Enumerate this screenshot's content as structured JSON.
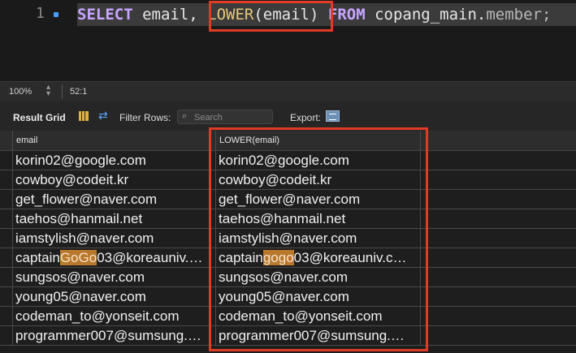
{
  "editor": {
    "line_number": "1",
    "code_parts": [
      {
        "text": "SELECT",
        "cls": "kw"
      },
      {
        "text": " email, ",
        "cls": "plain"
      },
      {
        "text": "LOWER",
        "cls": "fn"
      },
      {
        "text": "(email)",
        "cls": "plain"
      },
      {
        "text": " FROM",
        "cls": "kw2"
      },
      {
        "text": " copang_main.",
        "cls": "plain"
      },
      {
        "text": "member;",
        "cls": "dim"
      }
    ]
  },
  "status": {
    "zoom": "100%",
    "cursor": "52:1"
  },
  "toolbar": {
    "title": "Result Grid",
    "filter_label": "Filter Rows:",
    "search_placeholder": "Search",
    "export_label": "Export:"
  },
  "grid": {
    "columns": [
      "email",
      "LOWER(email)"
    ],
    "rows": [
      [
        "korin02@google.com",
        "korin02@google.com"
      ],
      [
        "cowboy@codeit.kr",
        "cowboy@codeit.kr"
      ],
      [
        "get_flower@naver.com",
        "get_flower@naver.com"
      ],
      [
        "taehos@hanmail.net",
        "taehos@hanmail.net"
      ],
      [
        "iamstylish@naver.com",
        "iamstylish@naver.com"
      ],
      [
        "captainGoGo03@koreauniv.…",
        "captaingogo03@koreauniv.c…"
      ],
      [
        "sungsos@naver.com",
        "sungsos@naver.com"
      ],
      [
        "young05@naver.com",
        "young05@naver.com"
      ],
      [
        "codeman_to@yonseit.com",
        "codeman_to@yonseit.com"
      ],
      [
        "programmer007@sumsung.…",
        "programmer007@sumsung.…"
      ]
    ],
    "highlights": {
      "row": 5,
      "col1": "GoGo",
      "col2": "gogo"
    }
  },
  "colors": {
    "annotation": "#e03b24",
    "highlight": "#b9782b"
  }
}
